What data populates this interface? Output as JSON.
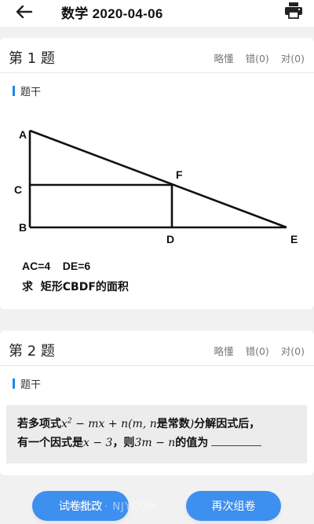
{
  "header": {
    "title": "数学 2020-04-06",
    "icons": {
      "back": "arrow-left-icon",
      "print": "printer-icon"
    }
  },
  "questions": [
    {
      "title": "第 1 题",
      "actions": {
        "skim": "略懂",
        "wrong": "错(0)",
        "right": "对(0)"
      },
      "stem_label": "题干",
      "figure": {
        "points": {
          "A": "A",
          "B": "B",
          "C": "C",
          "D": "D",
          "E": "E",
          "F": "F"
        },
        "given": "AC=4    DE=6",
        "ask": "求  矩形CBDF的面积"
      }
    },
    {
      "title": "第 2 题",
      "actions": {
        "skim": "略懂",
        "wrong": "错(0)",
        "right": "对(0)"
      },
      "stem_label": "题干",
      "text": {
        "p1": "若多项式",
        "m1": "x",
        "m1_sup": "2",
        "m2": " − mx + n(m, n",
        "p2": "是常数",
        "m3": ")",
        "p3": "分解因式后，",
        "p4": "有一个因式是",
        "m4": "x − 3",
        "p5": "，则",
        "m5": "3m − n",
        "p6": "的值为"
      }
    }
  ],
  "footer": {
    "left_button": "试卷批改",
    "right_button": "再次组卷",
    "watermark": "内容汇 · NJYCQH"
  }
}
